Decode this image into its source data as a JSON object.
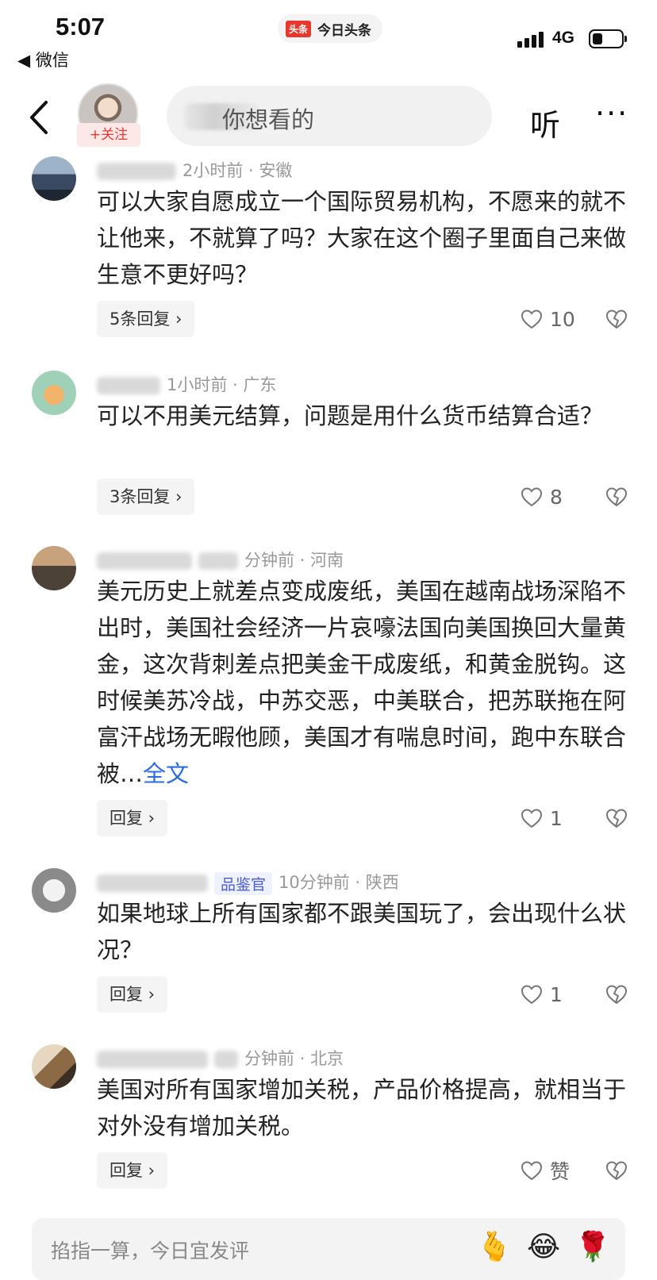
{
  "status_bar": {
    "time": "5:07",
    "back_app": "◀ 微信",
    "app_logo": "头条",
    "app_name": "今日头条",
    "network": "4G"
  },
  "nav": {
    "follow_label": "+关注",
    "search_placeholder": "你想看的",
    "listen_label": "听",
    "more_label": "···"
  },
  "comments": [
    {
      "meta": "2小时前 · 安徽",
      "text": "可以大家自愿成立一个国际贸易机构，不愿来的就不让他来，不就算了吗？大家在这个圈子里面自己来做生意不更好吗？",
      "reply_label": "5条回复 ›",
      "likes": "10"
    },
    {
      "meta": "1小时前 · 广东",
      "text": "可以不用美元结算，问题是用什么货币结算合适？",
      "reply_label": "3条回复 ›",
      "likes": "8"
    },
    {
      "meta": "分钟前 · 河南",
      "text": "美元历史上就差点变成废纸，美国在越南战场深陷不出时，美国社会经济一片哀嚎法国向美国换回大量黄金，这次背刺差点把美金干成废纸，和黄金脱钩。这时候美苏冷战，中苏交恶，中美联合，把苏联拖在阿富汗战场无暇他顾，美国才有喘息时间，跑中东联合被…",
      "more_link": "全文",
      "reply_label": "回复 ›",
      "likes": "1"
    },
    {
      "meta": "10分钟前 · 陕西",
      "badge": "品鉴官",
      "text": "如果地球上所有国家都不跟美国玩了，会出现什么状况？",
      "reply_label": "回复 ›",
      "likes": "1"
    },
    {
      "meta": "分钟前 · 北京",
      "text": "美国对所有国家增加关税，产品价格提高，就相当于对外没有增加关税。",
      "reply_label": "回复 ›",
      "likes": "赞"
    }
  ],
  "bottom": {
    "placeholder": "掐指一算，今日宜发评"
  }
}
